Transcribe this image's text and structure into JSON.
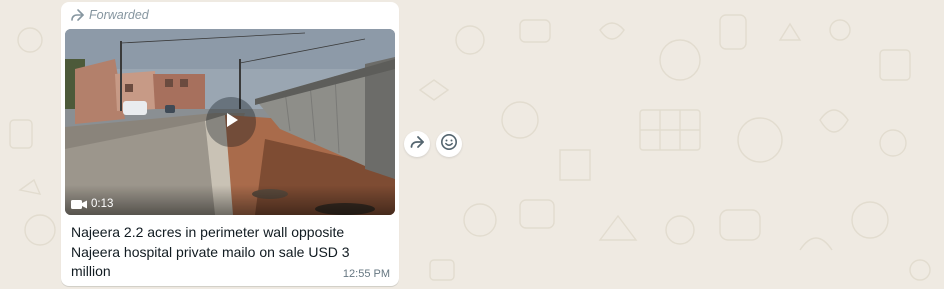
{
  "message": {
    "forwarded_label": "Forwarded",
    "video_duration": "0:13",
    "caption": "Najeera 2.2 acres in perimeter wall opposite Najeera hospital private mailo on sale USD 3 million",
    "timestamp": "12:55 PM"
  },
  "icons": {
    "forwarded": "forwarded-arrow-icon",
    "play": "play-icon",
    "video_camera": "video-camera-icon",
    "forward_action": "forward-icon",
    "reaction": "emoji-reaction-icon"
  },
  "colors": {
    "chat_background": "#efeae2",
    "bubble": "#ffffff",
    "meta_text": "#8696a0",
    "body_text": "#111b21",
    "timestamp_text": "#667781"
  }
}
